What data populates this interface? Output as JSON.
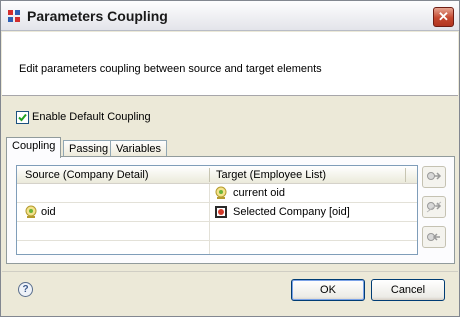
{
  "window": {
    "title": "Parameters Coupling",
    "close_symbol": "✕"
  },
  "banner": {
    "description": "Edit parameters coupling between source and target elements"
  },
  "enable_default": {
    "label": "Enable Default Coupling",
    "checked": true
  },
  "tabs": [
    {
      "label": "Coupling",
      "active": true
    },
    {
      "label": "Passing",
      "active": false
    },
    {
      "label": "Variables",
      "active": false
    }
  ],
  "table": {
    "headers": {
      "source": "Source (Company Detail)",
      "target": "Target (Employee List)"
    },
    "rows": [
      {
        "source": "",
        "target": "current oid",
        "target_icon": "parameter-icon"
      },
      {
        "source": "oid",
        "source_icon": "parameter-icon",
        "target": "Selected Company [oid]",
        "target_icon": "selection-parameter-icon"
      }
    ]
  },
  "side_buttons": [
    "couple-icon",
    "uncouple-icon",
    "remove-coupling-icon"
  ],
  "footer": {
    "help_symbol": "?",
    "ok_label": "OK",
    "cancel_label": "Cancel"
  },
  "colors": {
    "accent": "#003c74",
    "close_red": "#c4472f",
    "banner_bg": "#ffffff",
    "dialog_bg": "#ece9d8"
  }
}
